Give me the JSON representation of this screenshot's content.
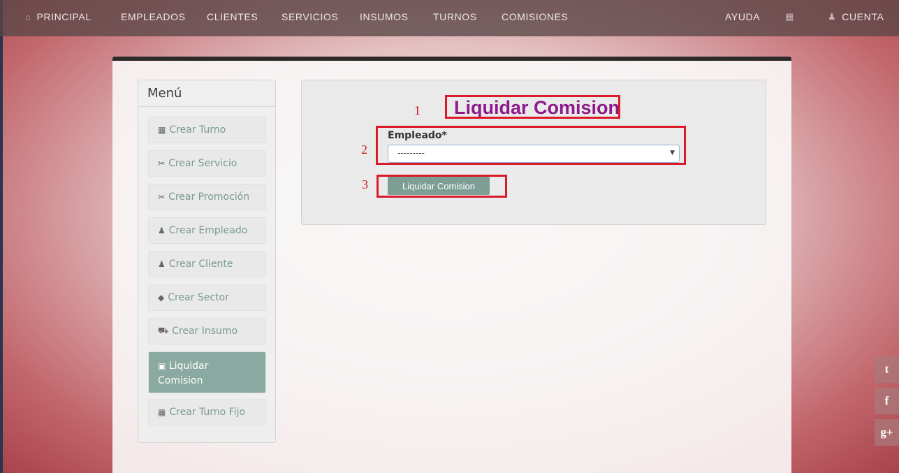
{
  "nav": {
    "items": [
      {
        "label": "PRINCIPAL",
        "icon": "home-icon",
        "glyph": "⌂"
      },
      {
        "label": "EMPLEADOS"
      },
      {
        "label": "CLIENTES"
      },
      {
        "label": "SERVICIOS"
      },
      {
        "label": "INSUMOS"
      },
      {
        "label": "TURNOS"
      },
      {
        "label": "COMISIONES"
      }
    ],
    "right": {
      "help_label": "AYUDA",
      "calendar_glyph": "▦",
      "account_label": "CUENTA",
      "account_glyph": "♟"
    }
  },
  "sidebar": {
    "heading": "Menú",
    "items": [
      {
        "label": "Crear Turno",
        "icon": "calendar-icon",
        "glyph": "▦"
      },
      {
        "label": "Crear Servicio",
        "icon": "scissors-icon",
        "glyph": "✂"
      },
      {
        "label": "Crear Promoción",
        "icon": "scissors-icon",
        "glyph": "✂"
      },
      {
        "label": "Crear Empleado",
        "icon": "user-icon",
        "glyph": "♟"
      },
      {
        "label": "Crear Cliente",
        "icon": "user-icon",
        "glyph": "♟"
      },
      {
        "label": "Crear Sector",
        "icon": "tags-icon",
        "glyph": "◆"
      },
      {
        "label": "Crear Insumo",
        "icon": "cart-icon",
        "glyph": "⛟"
      },
      {
        "label": "Liquidar Comision",
        "icon": "money-icon",
        "glyph": "▣",
        "active": true
      },
      {
        "label": "Crear Turno Fijo",
        "icon": "calendar-icon",
        "glyph": "▦"
      }
    ]
  },
  "form": {
    "title": "Liquidar Comision",
    "employee_label": "Empleado*",
    "employee_value": "---------",
    "submit_label": "Liquidar Comision"
  },
  "annotations": [
    "1",
    "2",
    "3"
  ],
  "social": [
    {
      "icon": "twitter-icon",
      "glyph": "t"
    },
    {
      "icon": "facebook-icon",
      "glyph": "f"
    },
    {
      "icon": "google-plus-icon",
      "glyph": "g+"
    }
  ],
  "colors": {
    "accent": "#8aa9a1",
    "title": "#8d1a8d",
    "annotation": "#d91b2a"
  }
}
